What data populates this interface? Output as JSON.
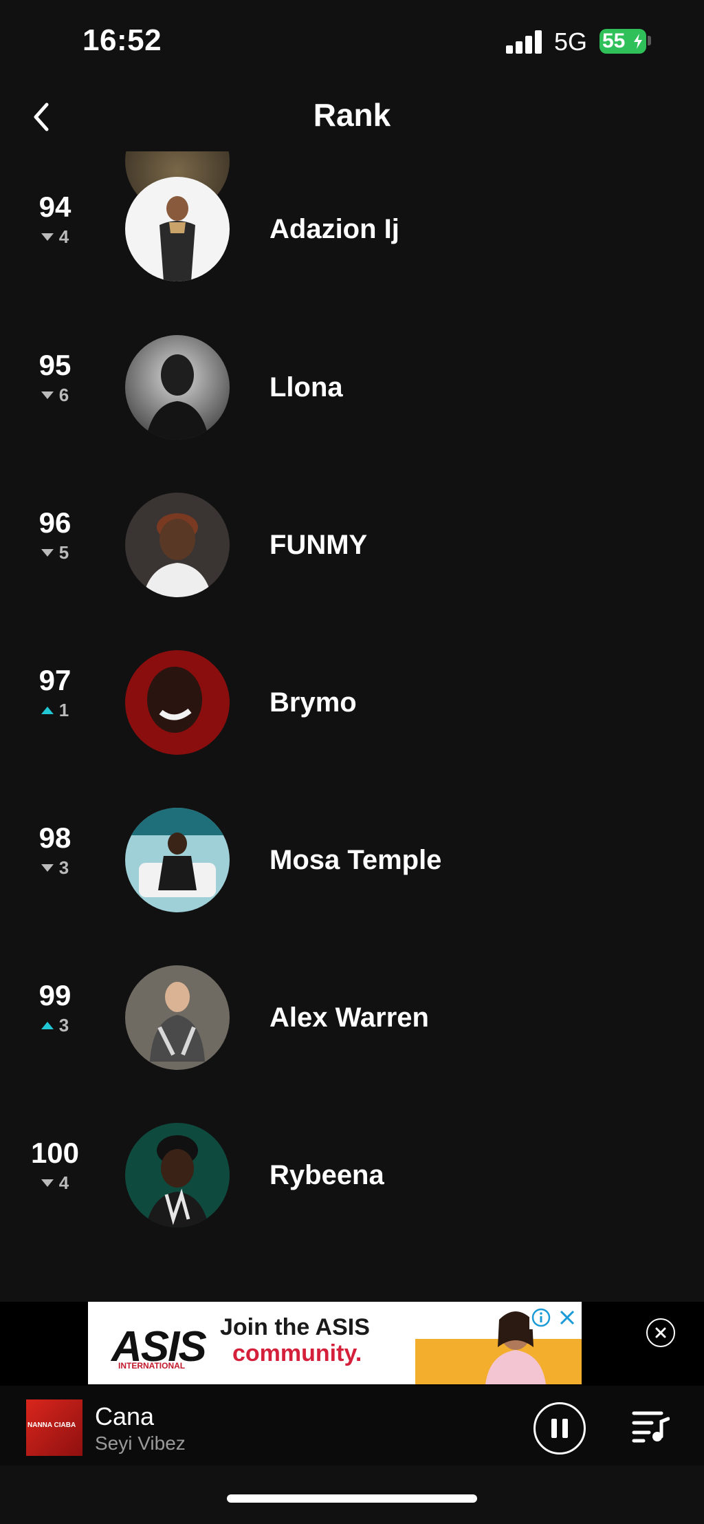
{
  "status_bar": {
    "time": "16:52",
    "network": "5G",
    "battery": "55"
  },
  "nav": {
    "title": "Rank",
    "back_icon": "chevron-left-icon"
  },
  "rankings": [
    {
      "rank": "94",
      "change": "4",
      "direction": "down",
      "name": "Adazion Ij"
    },
    {
      "rank": "95",
      "change": "6",
      "direction": "down",
      "name": "Llona"
    },
    {
      "rank": "96",
      "change": "5",
      "direction": "down",
      "name": "FUNMY"
    },
    {
      "rank": "97",
      "change": "1",
      "direction": "up",
      "name": "Brymo"
    },
    {
      "rank": "98",
      "change": "3",
      "direction": "down",
      "name": "Mosa Temple"
    },
    {
      "rank": "99",
      "change": "3",
      "direction": "up",
      "name": "Alex Warren"
    },
    {
      "rank": "100",
      "change": "4",
      "direction": "down",
      "name": "Rybeena"
    }
  ],
  "ad": {
    "logo": "ASIS",
    "logo_sub": "INTERNATIONAL",
    "line1": "Join the ASIS",
    "line2": "community."
  },
  "player": {
    "title": "Cana",
    "artist": "Seyi Vibez",
    "cover_text": "NANNA CIABA"
  },
  "colors": {
    "background": "#111112",
    "up_arrow": "#22c7d4",
    "down_arrow": "#bbbbbb",
    "battery": "#30c05a"
  }
}
